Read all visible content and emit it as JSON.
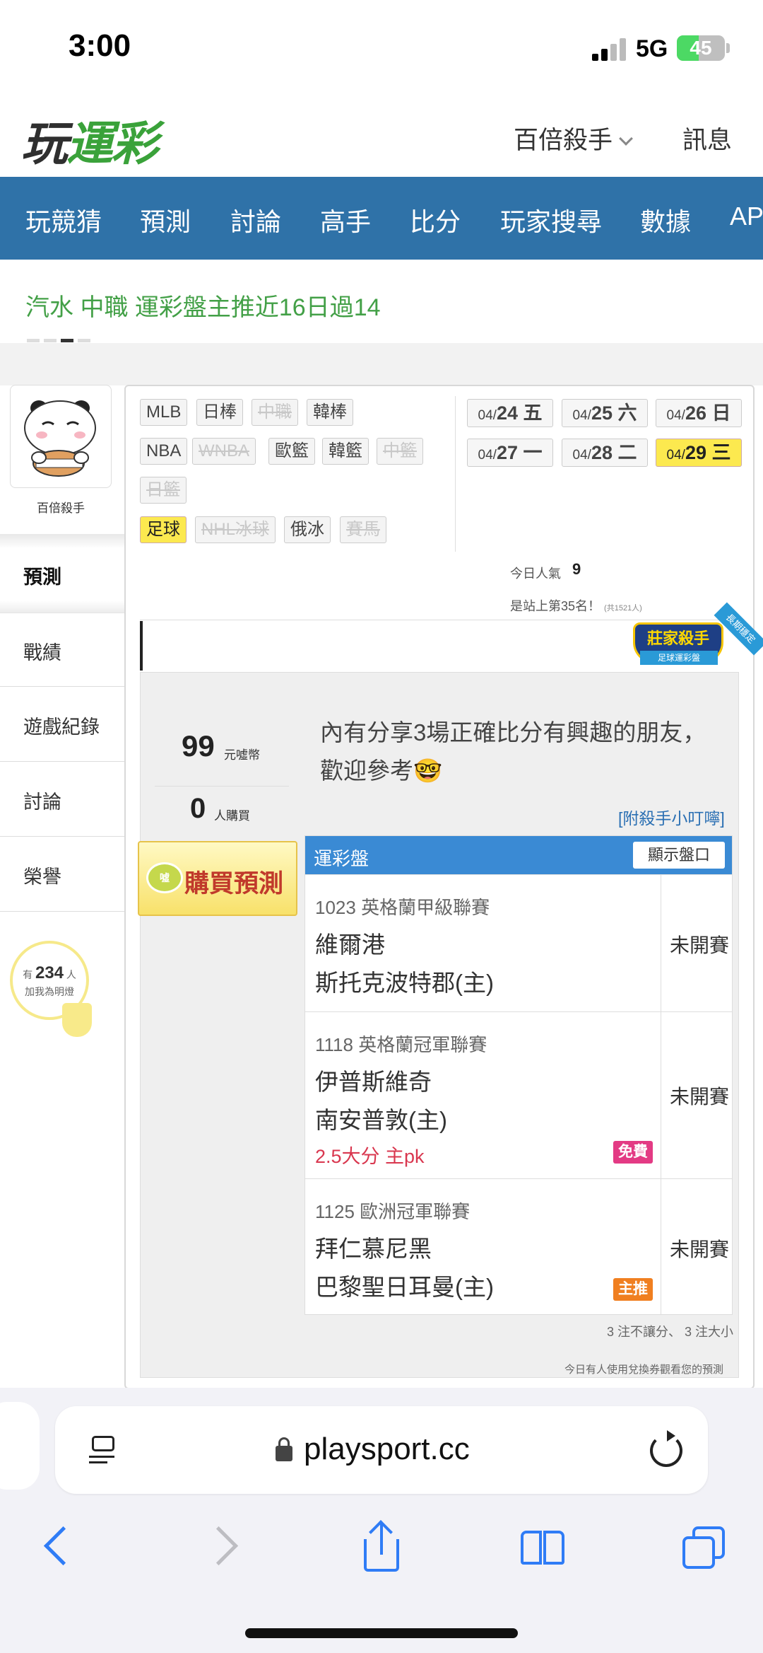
{
  "status_bar": {
    "time": "3:00",
    "network": "5G",
    "battery": "45",
    "battery_level": 0.45
  },
  "header": {
    "logo_text_a": "玩",
    "logo_text_b": "運彩",
    "user_menu": "百倍殺手",
    "messages": "訊息"
  },
  "nav": {
    "items": [
      "玩競猜",
      "預測",
      "討論",
      "高手",
      "比分",
      "玩家搜尋",
      "數據",
      "AP"
    ]
  },
  "ticker": {
    "text": "汽水 中職 運彩盤主推近16日過14"
  },
  "profile": {
    "name": "百倍殺手"
  },
  "sidebar": {
    "tabs": [
      "預測",
      "戰績",
      "遊戲紀錄",
      "討論",
      "榮譽"
    ],
    "fans_prefix": "有",
    "fans_count": "234",
    "fans_suffix": "人",
    "fans_label": "加我為明燈"
  },
  "sport_tags": [
    {
      "label": "MLB",
      "state": "normal"
    },
    {
      "label": "日棒",
      "state": "normal"
    },
    {
      "label": "中職",
      "state": "disabled"
    },
    {
      "label": "韓棒",
      "state": "normal"
    },
    {
      "label": "NBA",
      "state": "normal"
    },
    {
      "label": "WNBA",
      "state": "disabled"
    },
    {
      "label": "歐籃",
      "state": "normal"
    },
    {
      "label": "韓籃",
      "state": "normal"
    },
    {
      "label": "中籃",
      "state": "disabled"
    },
    {
      "label": "日籃",
      "state": "disabled"
    },
    {
      "label": "足球",
      "state": "selected"
    },
    {
      "label": "NHL冰球",
      "state": "disabled"
    },
    {
      "label": "俄冰",
      "state": "normal"
    },
    {
      "label": "賽馬",
      "state": "disabled"
    }
  ],
  "dates": [
    {
      "md": "04/",
      "day": "24 五",
      "selected": false
    },
    {
      "md": "04/",
      "day": "25 六",
      "selected": false
    },
    {
      "md": "04/",
      "day": "26 日",
      "selected": false
    },
    {
      "md": "04/",
      "day": "27 一",
      "selected": false
    },
    {
      "md": "04/",
      "day": "28 二",
      "selected": false
    },
    {
      "md": "04/",
      "day": "29 三",
      "selected": true
    }
  ],
  "popularity": {
    "label": "今日人氣",
    "value": "9",
    "rank_text": "是站上第35名！",
    "rank_total": "(共1521人)"
  },
  "badge": {
    "title": "莊家殺手",
    "sub": "足球運彩盤",
    "ribbon": "長期穩定"
  },
  "prediction": {
    "price": "99",
    "price_unit": "元噓幣",
    "buyers": "0",
    "buyers_unit": "人購買",
    "description": "內有分享3場正確比分有興趣的朋友，歡迎參考🤓",
    "tips_link": "[附殺手小叮嚀]",
    "buy_button": "購買預測",
    "buy_coin": "噓"
  },
  "odds_table": {
    "header": "運彩盤",
    "show_odds": "顯示盤口",
    "games": [
      {
        "league": "1023 英格蘭甲級聯賽",
        "team1": "維爾港",
        "team2": "斯托克波特郡(主)",
        "pick": "",
        "tag": "",
        "status": "未開賽"
      },
      {
        "league": "1118 英格蘭冠軍聯賽",
        "team1": "伊普斯維奇",
        "team2": "南安普敦(主)",
        "pick": "2.5大分 主pk",
        "tag": "免費",
        "status": "未開賽"
      },
      {
        "league": "1125 歐洲冠軍聯賽",
        "team1": "拜仁慕尼黑",
        "team2": "巴黎聖日耳曼(主)",
        "pick": "",
        "tag": "主推",
        "status": "未開賽"
      }
    ],
    "summary": "3 注不讓分、 3 注大小",
    "footer_note": "今日有人使用兌換券觀看您的預測"
  },
  "safari": {
    "url": "playsport.cc"
  }
}
